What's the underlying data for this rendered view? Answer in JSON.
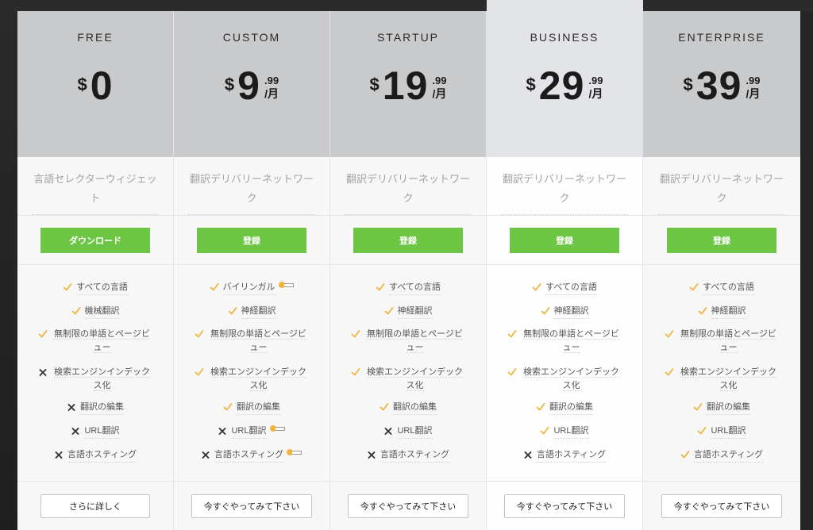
{
  "plans": [
    {
      "id": "free",
      "name": "FREE",
      "currency": "$",
      "amount": "0",
      "cents": "",
      "period": "",
      "description": "言語セレクターウィジェット",
      "cta_label": "ダウンロード",
      "secondary_label": "さらに詳しく",
      "features": [
        {
          "label": "すべての言語",
          "included": true
        },
        {
          "label": "機械翻訳",
          "included": true
        },
        {
          "label": "無制限の単語とページビュー",
          "included": true
        },
        {
          "label": "検索エンジンインデックス化",
          "included": false
        },
        {
          "label": "翻訳の編集",
          "included": false
        },
        {
          "label": "URL翻訳",
          "included": false
        },
        {
          "label": "言語ホスティング",
          "included": false
        }
      ]
    },
    {
      "id": "custom",
      "name": "CUSTOM",
      "currency": "$",
      "amount": "9",
      "cents": ".99",
      "period": "/月",
      "description": "翻訳デリバリーネットワーク",
      "cta_label": "登録",
      "secondary_label": "今すぐやってみて下さい",
      "features": [
        {
          "label": "バイリンガル",
          "included": true,
          "toggle": true
        },
        {
          "label": "神経翻訳",
          "included": true
        },
        {
          "label": "無制限の単語とページビュー",
          "included": true
        },
        {
          "label": "検索エンジンインデックス化",
          "included": true
        },
        {
          "label": "翻訳の編集",
          "included": true
        },
        {
          "label": "URL翻訳",
          "included": false,
          "toggle": true
        },
        {
          "label": "言語ホスティング",
          "included": false,
          "toggle": true
        }
      ]
    },
    {
      "id": "startup",
      "name": "STARTUP",
      "currency": "$",
      "amount": "19",
      "cents": ".99",
      "period": "/月",
      "description": "翻訳デリバリーネットワーク",
      "cta_label": "登録",
      "secondary_label": "今すぐやってみて下さい",
      "features": [
        {
          "label": "すべての言語",
          "included": true
        },
        {
          "label": "神経翻訳",
          "included": true
        },
        {
          "label": "無制限の単語とページビュー",
          "included": true
        },
        {
          "label": "検索エンジンインデックス化",
          "included": true
        },
        {
          "label": "翻訳の編集",
          "included": true
        },
        {
          "label": "URL翻訳",
          "included": false
        },
        {
          "label": "言語ホスティング",
          "included": false
        }
      ]
    },
    {
      "id": "business",
      "name": "BUSINESS",
      "currency": "$",
      "amount": "29",
      "cents": ".99",
      "period": "/月",
      "description": "翻訳デリバリーネットワーク",
      "cta_label": "登録",
      "secondary_label": "今すぐやってみて下さい",
      "features": [
        {
          "label": "すべての言語",
          "included": true
        },
        {
          "label": "神経翻訳",
          "included": true
        },
        {
          "label": "無制限の単語とページビュー",
          "included": true
        },
        {
          "label": "検索エンジンインデックス化",
          "included": true
        },
        {
          "label": "翻訳の編集",
          "included": true
        },
        {
          "label": "URL翻訳",
          "included": true
        },
        {
          "label": "言語ホスティング",
          "included": false
        }
      ]
    },
    {
      "id": "enterprise",
      "name": "ENTERPRISE",
      "currency": "$",
      "amount": "39",
      "cents": ".99",
      "period": "/月",
      "description": "翻訳デリバリーネットワーク",
      "cta_label": "登録",
      "secondary_label": "今すぐやってみて下さい",
      "features": [
        {
          "label": "すべての言語",
          "included": true
        },
        {
          "label": "神経翻訳",
          "included": true
        },
        {
          "label": "無制限の単語とページビュー",
          "included": true
        },
        {
          "label": "検索エンジンインデックス化",
          "included": true
        },
        {
          "label": "翻訳の編集",
          "included": true
        },
        {
          "label": "URL翻訳",
          "included": true
        },
        {
          "label": "言語ホスティング",
          "included": true
        }
      ]
    }
  ],
  "featured_plan": "business",
  "colors": {
    "header_gray": "#c9cacc",
    "featured_header": "#e3e4e8",
    "cta_green": "#6cc644",
    "check_orange": "#f0b43a",
    "cross_dark": "#333333"
  },
  "icons": {
    "included": "check-icon",
    "excluded": "cross-icon",
    "toggle": "toggle-icon"
  }
}
